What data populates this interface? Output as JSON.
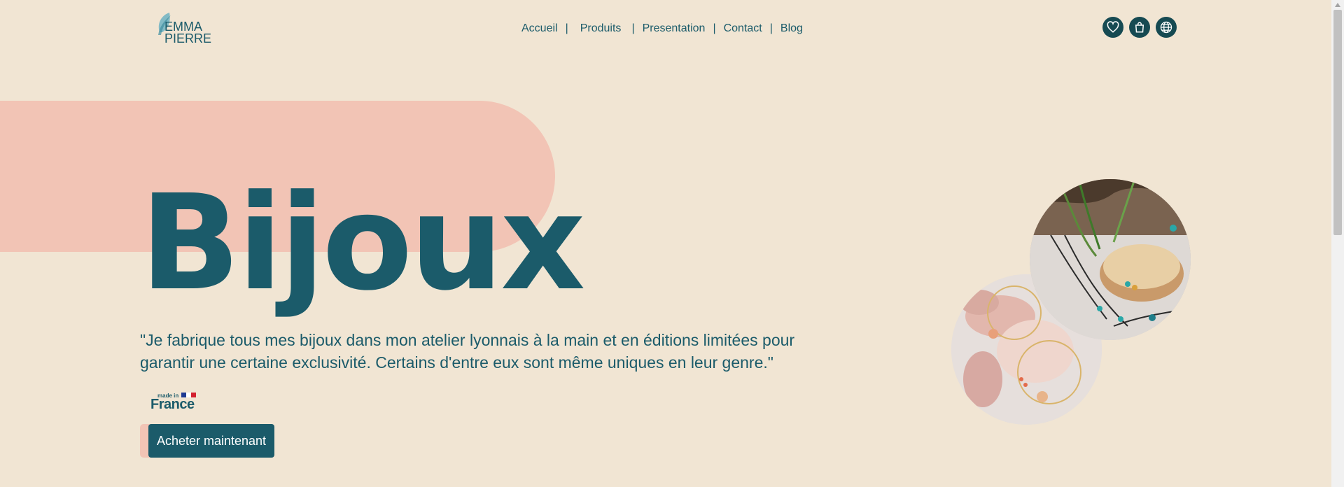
{
  "logo": {
    "line1": "EMMA",
    "line2": "PIERRE"
  },
  "nav": {
    "items": [
      "Accueil",
      "Produits",
      "Presentation",
      "Contact",
      "Blog"
    ],
    "separator": "|"
  },
  "header_icons": [
    "heart-icon",
    "shopping-bag-icon",
    "globe-icon"
  ],
  "hero": {
    "title": "Bijoux",
    "quote": "\"Je fabrique tous mes bijoux dans mon atelier lyonnais à la main et en éditions limitées pour garantir une certaine exclusivité. Certains d'entre eux sont même uniques en leur genre.\"",
    "badge_small": "made in",
    "badge_big": "France",
    "cta": "Acheter maintenant"
  },
  "colors": {
    "background": "#f1e5d3",
    "primary": "#1b5b6a",
    "accent": "#f2c4b5",
    "icon_bg": "#164a52"
  }
}
